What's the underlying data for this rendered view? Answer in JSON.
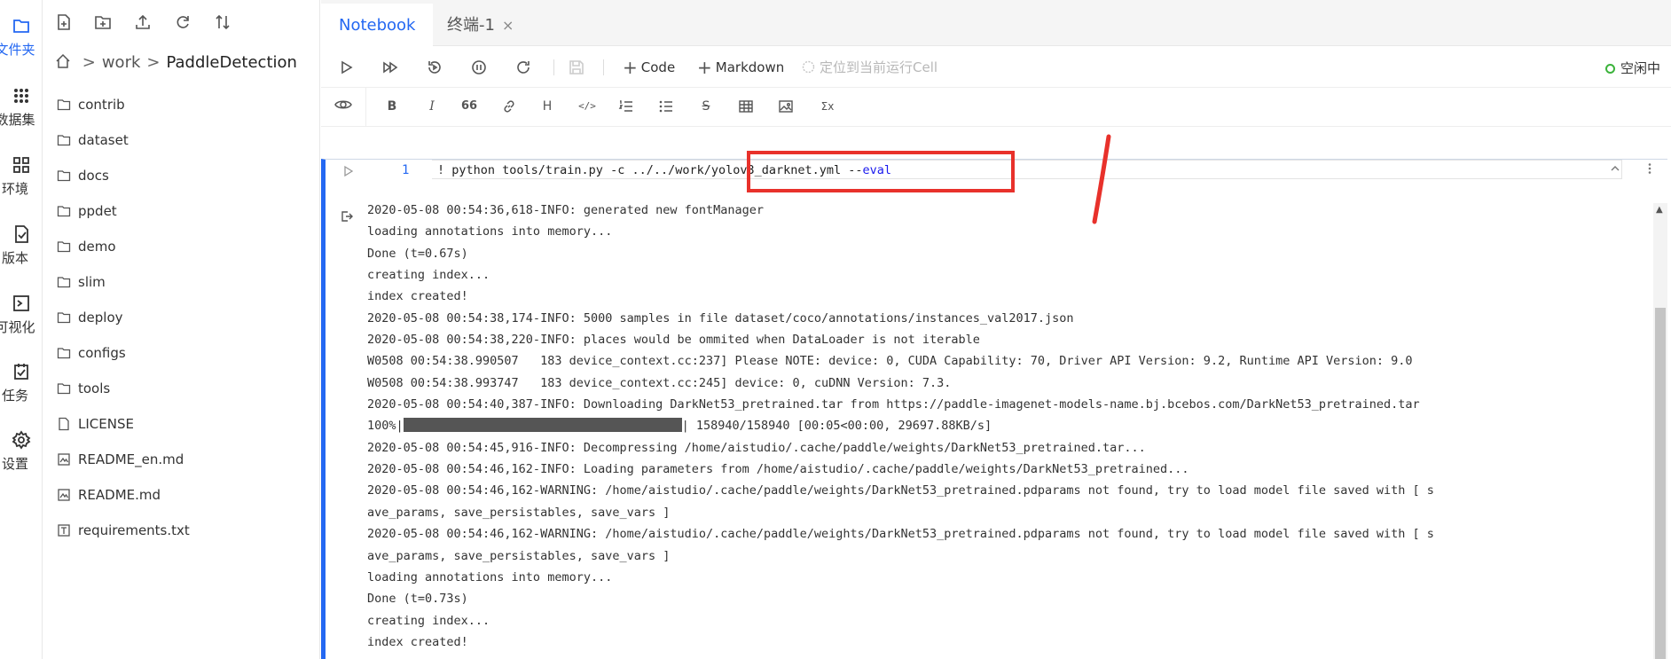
{
  "activity_bar": [
    {
      "label": "文件夹",
      "icon": "folder-icon",
      "active": true
    },
    {
      "label": "数据集",
      "icon": "dataset-icon"
    },
    {
      "label": "环境",
      "icon": "environment-icon"
    },
    {
      "label": "版本",
      "icon": "version-icon"
    },
    {
      "label": "可视化",
      "icon": "visualization-icon"
    },
    {
      "label": "任务",
      "icon": "task-icon"
    },
    {
      "label": "设置",
      "icon": "settings-icon"
    }
  ],
  "file_panel": {
    "breadcrumb": {
      "root": "work",
      "current": "PaddleDetection",
      "sep": ">"
    },
    "files": [
      {
        "name": "contrib",
        "type": "folder"
      },
      {
        "name": "dataset",
        "type": "folder"
      },
      {
        "name": "docs",
        "type": "folder"
      },
      {
        "name": "ppdet",
        "type": "folder"
      },
      {
        "name": "demo",
        "type": "folder"
      },
      {
        "name": "slim",
        "type": "folder"
      },
      {
        "name": "deploy",
        "type": "folder"
      },
      {
        "name": "configs",
        "type": "folder"
      },
      {
        "name": "tools",
        "type": "folder"
      },
      {
        "name": "LICENSE",
        "type": "file"
      },
      {
        "name": "README_en.md",
        "type": "markdown"
      },
      {
        "name": "README.md",
        "type": "markdown"
      },
      {
        "name": "requirements.txt",
        "type": "text"
      }
    ]
  },
  "tabs": [
    {
      "label": "Notebook",
      "active": true
    },
    {
      "label": "终端-1",
      "closable": true,
      "close_glyph": "×"
    }
  ],
  "toolbar": {
    "code_label": "Code",
    "markdown_label": "Markdown",
    "locate_label": "定位到当前运行Cell",
    "status_label": "空闲中",
    "status_color": "#3bb33b"
  },
  "markdown_toolbar": {
    "bold": "B",
    "italic": "I",
    "quote": "66",
    "heading": "H",
    "code": "</>",
    "strike": "S",
    "formula": "Σx"
  },
  "cell": {
    "line_number": "1",
    "code_prefix": "! python tools/train.py -c ../../work/yolov3_darknet.yml --",
    "code_keyword": "eval",
    "output_lines": [
      "2020-05-08 00:54:36,618-INFO: generated new fontManager",
      "loading annotations into memory...",
      "Done (t=0.67s)",
      "creating index...",
      "index created!",
      "2020-05-08 00:54:38,174-INFO: 5000 samples in file dataset/coco/annotations/instances_val2017.json",
      "2020-05-08 00:54:38,220-INFO: places would be ommited when DataLoader is not iterable",
      "W0508 00:54:38.990507   183 device_context.cc:237] Please NOTE: device: 0, CUDA Capability: 70, Driver API Version: 9.2, Runtime API Version: 9.0",
      "W0508 00:54:38.993747   183 device_context.cc:245] device: 0, cuDNN Version: 7.3.",
      "2020-05-08 00:54:40,387-INFO: Downloading DarkNet53_pretrained.tar from https://paddle-imagenet-models-name.bj.bcebos.com/DarkNet53_pretrained.tar"
    ],
    "progress_prefix": "100%|",
    "progress_suffix": "| 158940/158940 [00:05<00:00, 29697.88KB/s]",
    "progress_fraction": 1.0,
    "output_lines_after": [
      "2020-05-08 00:54:45,916-INFO: Decompressing /home/aistudio/.cache/paddle/weights/DarkNet53_pretrained.tar...",
      "2020-05-08 00:54:46,162-INFO: Loading parameters from /home/aistudio/.cache/paddle/weights/DarkNet53_pretrained...",
      "2020-05-08 00:54:46,162-WARNING: /home/aistudio/.cache/paddle/weights/DarkNet53_pretrained.pdparams not found, try to load model file saved with [ s",
      "ave_params, save_persistables, save_vars ]",
      "2020-05-08 00:54:46,162-WARNING: /home/aistudio/.cache/paddle/weights/DarkNet53_pretrained.pdparams not found, try to load model file saved with [ s",
      "ave_params, save_persistables, save_vars ]",
      "loading annotations into memory...",
      "Done (t=0.73s)",
      "creating index...",
      "index created!"
    ]
  },
  "annotation_color": "#e8312b"
}
